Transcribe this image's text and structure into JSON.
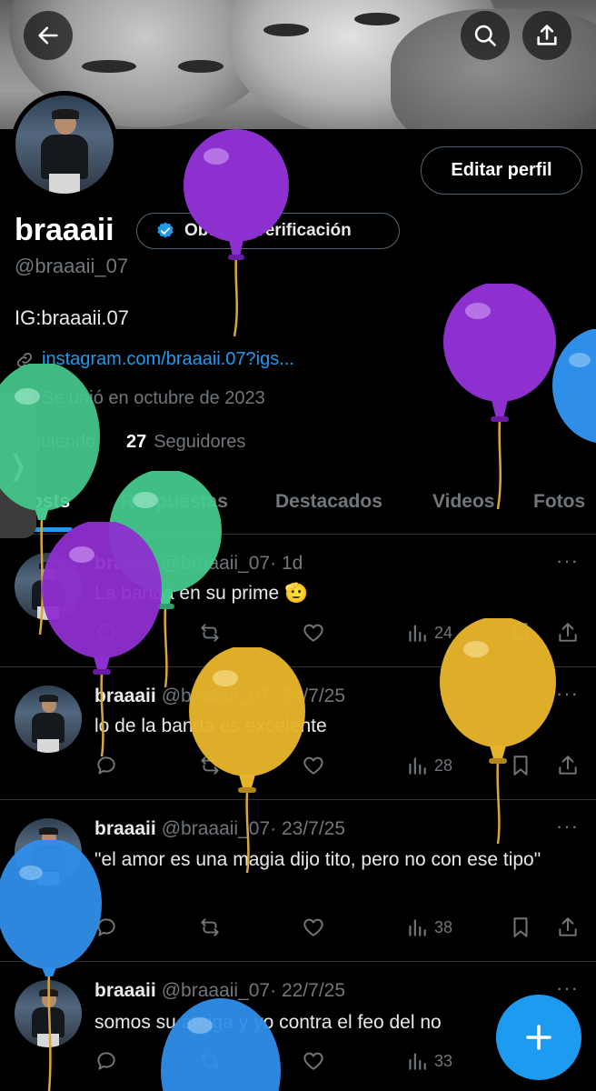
{
  "header": {
    "back_icon": "arrow-left-icon",
    "search_icon": "search-icon",
    "share_icon": "share-icon"
  },
  "profile": {
    "name": "braaaii",
    "verify_label": "Obtener verificación",
    "edit_label": "Editar perfil",
    "handle": "@braaaii_07",
    "bio": "IG:braaaii.07",
    "link": "instagram.com/braaaii.07?igs...",
    "joined": "Se unió en octubre de 2023",
    "following_label": "Siguiendo",
    "followers_count": "27",
    "followers_label": "Seguidores"
  },
  "side_handle": "❭",
  "tabs": [
    "Posts",
    "Respuestas",
    "Destacados",
    "Videos",
    "Fotos"
  ],
  "tweets": [
    {
      "name": "braaaii",
      "handle": "@braaaii_07",
      "time": "· 1d",
      "text": "La banda en su prime 🫡",
      "views": "24"
    },
    {
      "name": "braaaii",
      "handle": "@braaaii_07",
      "time": "· 24/7/25",
      "text": "lo de la banda es excelente",
      "views": "28"
    },
    {
      "name": "braaaii",
      "handle": "@braaaii_07",
      "time": "· 23/7/25",
      "text": "\"el amor es una magia dijo tito, pero no con ese tipo\"",
      "views": "38"
    },
    {
      "name": "braaaii",
      "handle": "@braaaii_07",
      "time": "· 22/7/25",
      "text": "somos su amiga y yo contra el feo del no",
      "views": "33"
    }
  ],
  "more_glyph": "···",
  "colors": {
    "accent": "#1d9bf0",
    "balloon_purple": "#8e2fd0",
    "balloon_green": "#45c98e",
    "balloon_yellow": "#e5b42a",
    "balloon_blue": "#2f8ee8"
  }
}
